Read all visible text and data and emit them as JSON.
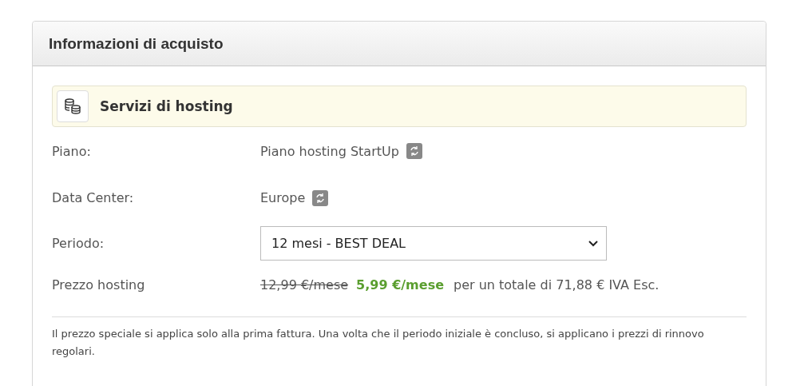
{
  "panel": {
    "title": "Informazioni di acquisto"
  },
  "service": {
    "title": "Servizi di hosting"
  },
  "fields": [
    {
      "kind": "text",
      "label": "Piano:",
      "value": "Piano hosting StartUp",
      "changeable": true
    },
    {
      "kind": "text",
      "label": "Data Center:",
      "value": "Europe",
      "changeable": true
    },
    {
      "kind": "select",
      "label": "Periodo:",
      "value": "12 mesi - BEST DEAL"
    },
    {
      "kind": "price",
      "label": "Prezzo hosting",
      "old_price": "12,99 €/mese",
      "new_price": "5,99 €/mese",
      "total": "per un totale di 71,88 € IVA Esc."
    }
  ],
  "note": "Il prezzo speciale si applica solo alla prima fattura. Una volta che il periodo iniziale è concluso, si applicano i prezzi di rinnovo regolari."
}
